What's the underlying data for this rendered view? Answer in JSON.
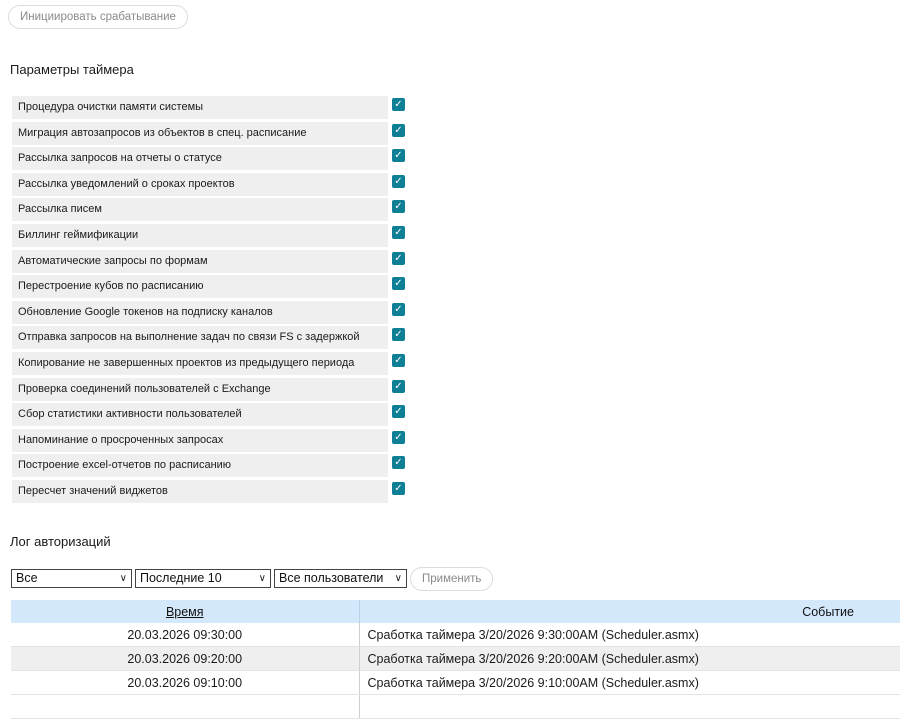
{
  "trigger_button": "Инициировать срабатывание",
  "timer_section": {
    "title": "Параметры таймера",
    "items": [
      {
        "label": "Процедура очистки памяти системы",
        "checked": true
      },
      {
        "label": "Миграция автозапросов из объектов в спец. расписание",
        "checked": true
      },
      {
        "label": "Рассылка запросов на отчеты о статусе",
        "checked": true
      },
      {
        "label": "Рассылка уведомлений о сроках проектов",
        "checked": true
      },
      {
        "label": "Рассылка писем",
        "checked": true
      },
      {
        "label": "Биллинг геймификации",
        "checked": true
      },
      {
        "label": "Автоматические запросы по формам",
        "checked": true
      },
      {
        "label": "Перестроение кубов по расписанию",
        "checked": true
      },
      {
        "label": "Обновление Google токенов на подписку каналов",
        "checked": true
      },
      {
        "label": "Отправка запросов на выполнение задач по связи FS с задержкой",
        "checked": true
      },
      {
        "label": "Копирование не завершенных проектов из предыдущего периода",
        "checked": true
      },
      {
        "label": "Проверка соединений пользователей с Exchange",
        "checked": true
      },
      {
        "label": "Сбор статистики активности пользователей",
        "checked": true
      },
      {
        "label": "Напоминание о просроченных запросах",
        "checked": true
      },
      {
        "label": "Построение excel-отчетов по расписанию",
        "checked": true
      },
      {
        "label": "Пересчет значений виджетов",
        "checked": true
      }
    ]
  },
  "log_section": {
    "title": "Лог авторизаций",
    "filters": {
      "type": "Все",
      "count": "Последние 10",
      "users": "Все пользователи"
    },
    "apply_button": "Применить",
    "columns": {
      "time": "Время",
      "event": "Событие"
    },
    "rows": [
      {
        "time": "20.03.2026 09:30:00",
        "event": "Сработка таймера 3/20/2026 9:30:00AM (Scheduler.asmx)"
      },
      {
        "time": "20.03.2026 09:20:00",
        "event": "Сработка таймера 3/20/2026 9:20:00AM (Scheduler.asmx)"
      },
      {
        "time": "20.03.2026 09:10:00",
        "event": "Сработка таймера 3/20/2026 9:10:00AM (Scheduler.asmx)"
      }
    ]
  }
}
